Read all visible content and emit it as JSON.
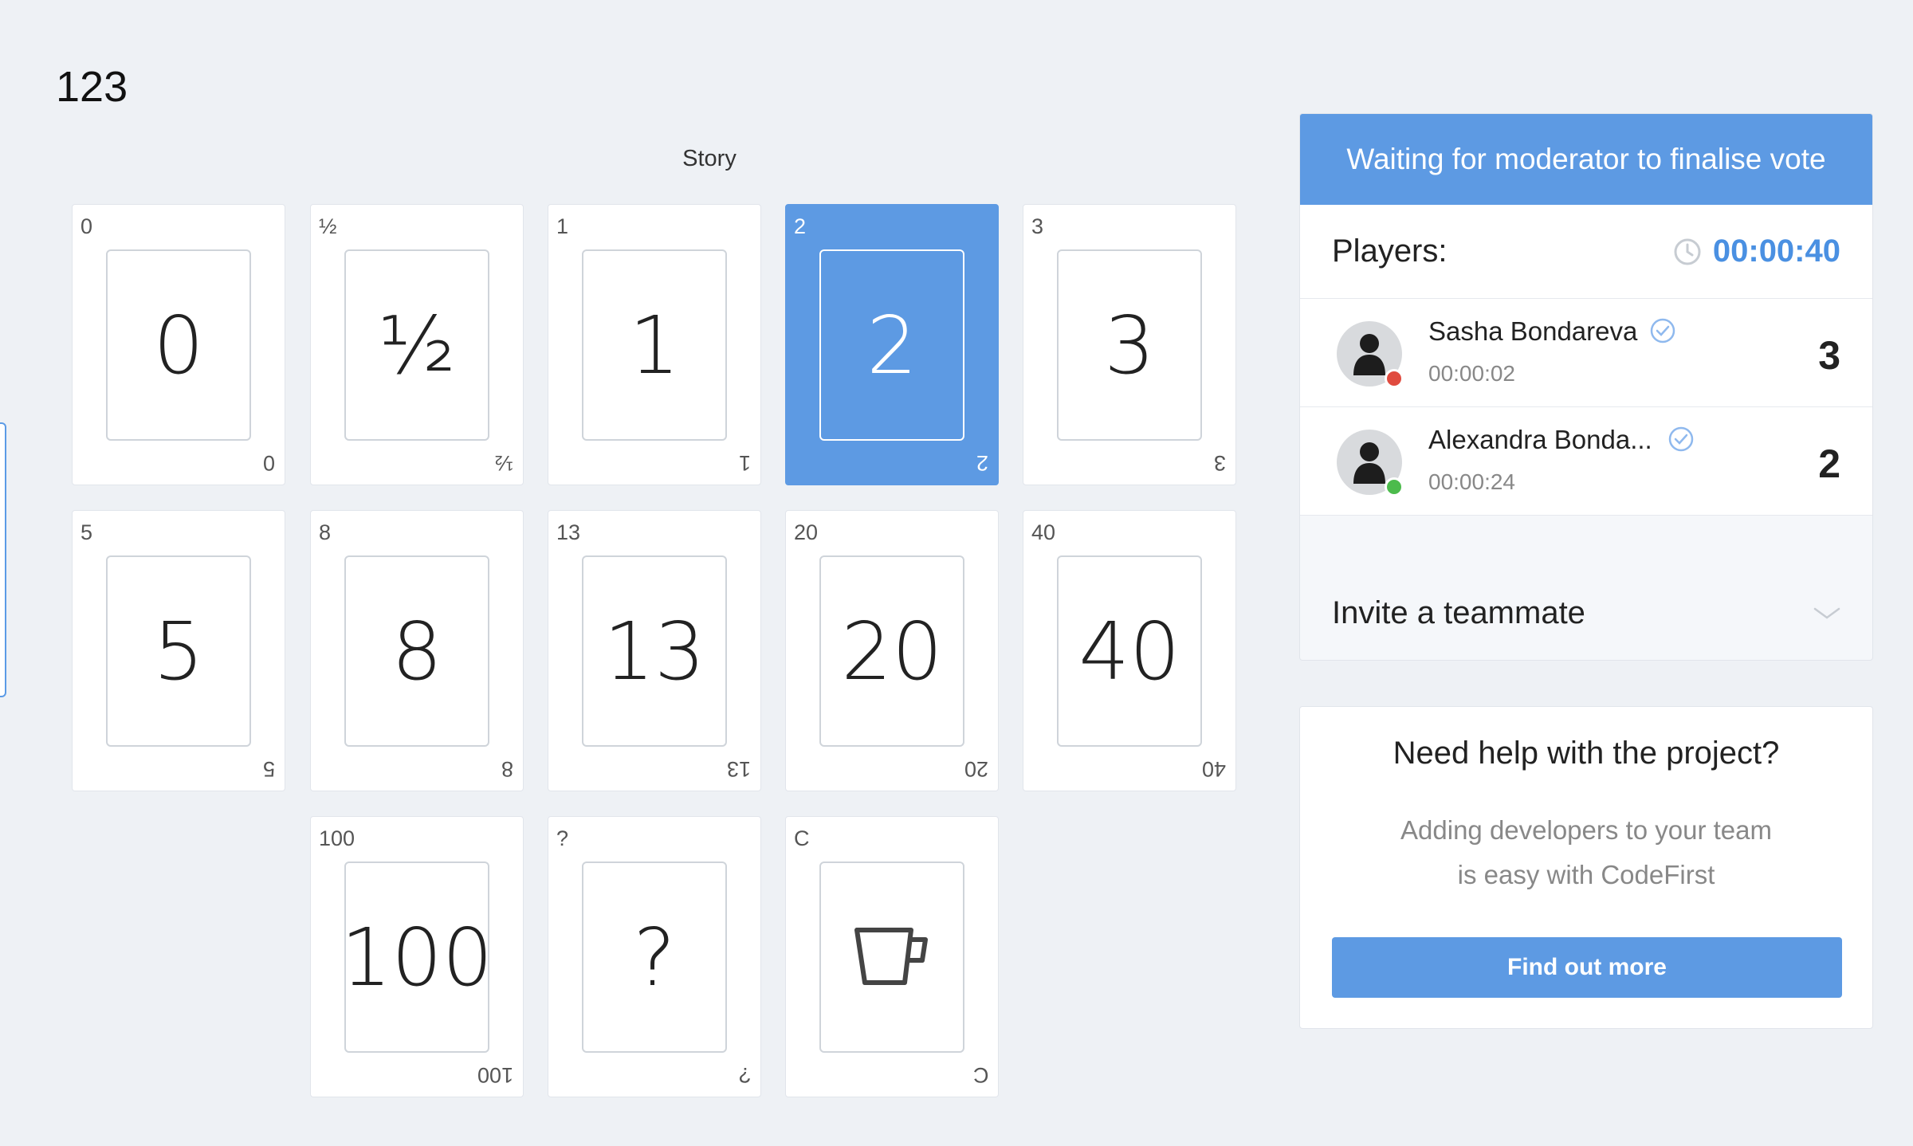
{
  "room": {
    "title": "123"
  },
  "story": {
    "label": "Story"
  },
  "cards": [
    {
      "value": "0",
      "selected": false,
      "icon": null
    },
    {
      "value": "½",
      "selected": false,
      "icon": null
    },
    {
      "value": "1",
      "selected": false,
      "icon": null
    },
    {
      "value": "2",
      "selected": true,
      "icon": null
    },
    {
      "value": "3",
      "selected": false,
      "icon": null
    },
    {
      "value": "5",
      "selected": false,
      "icon": null
    },
    {
      "value": "8",
      "selected": false,
      "icon": null
    },
    {
      "value": "13",
      "selected": false,
      "icon": null
    },
    {
      "value": "20",
      "selected": false,
      "icon": null
    },
    {
      "value": "40",
      "selected": false,
      "icon": null
    },
    {
      "value": "100",
      "selected": false,
      "icon": null
    },
    {
      "value": "?",
      "selected": false,
      "icon": null
    },
    {
      "value": "C",
      "selected": false,
      "icon": "coffee-cup-icon"
    }
  ],
  "panel": {
    "header": "Waiting for moderator to finalise vote",
    "players_label": "Players:",
    "timer": "00:00:40",
    "players": [
      {
        "name": "Sasha Bondareva",
        "time": "00:00:02",
        "vote": "3",
        "status_color": "#e04b3f"
      },
      {
        "name": "Alexandra Bonda...",
        "time": "00:00:24",
        "vote": "2",
        "status_color": "#4cbb4c"
      }
    ],
    "invite_label": "Invite a teammate"
  },
  "help": {
    "title": "Need help with the project?",
    "desc_line1": "Adding developers to your team",
    "desc_line2": "is easy with CodeFirst",
    "button": "Find out more"
  },
  "colors": {
    "accent": "#5d9ae3",
    "timer": "#4a90e2"
  }
}
